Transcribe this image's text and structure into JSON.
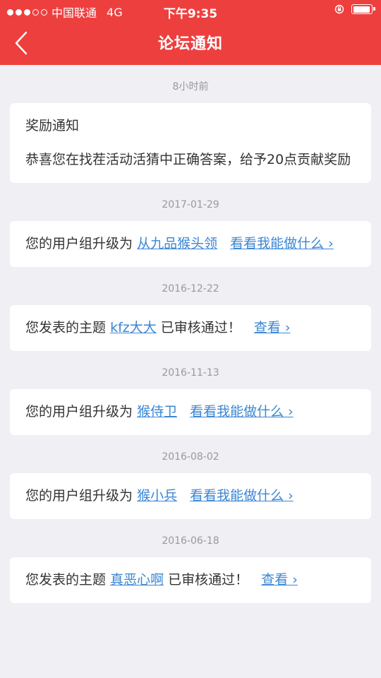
{
  "status_bar": {
    "carrier": "中国联通",
    "network": "4G",
    "time": "下午9:35"
  },
  "nav": {
    "title": "论坛通知"
  },
  "notifications": [
    {
      "date": "8小时前",
      "title": "奖励通知",
      "body": "恭喜您在找茬活动活猜中正确答案，给予20点贡献奖励"
    },
    {
      "date": "2017-01-29",
      "prefix": "您的用户组升级为",
      "link": "从九品猴头领",
      "action": "看看我能做什么 ›"
    },
    {
      "date": "2016-12-22",
      "prefix": "您发表的主题",
      "link": "kfz大大",
      "suffix": "已审核通过！",
      "action": "查看 ›"
    },
    {
      "date": "2016-11-13",
      "prefix": "您的用户组升级为",
      "link": "猴侍卫",
      "action": "看看我能做什么 ›"
    },
    {
      "date": "2016-08-02",
      "prefix": "您的用户组升级为",
      "link": "猴小兵",
      "action": "看看我能做什么 ›"
    },
    {
      "date": "2016-06-18",
      "prefix": "您发表的主题",
      "link": "真恶心啊",
      "suffix": "已审核通过！",
      "action": "查看 ›"
    }
  ],
  "colors": {
    "header": "#ee3f3f",
    "background": "#efeff4",
    "link": "#3a86d4",
    "date": "#9a9a9a"
  }
}
